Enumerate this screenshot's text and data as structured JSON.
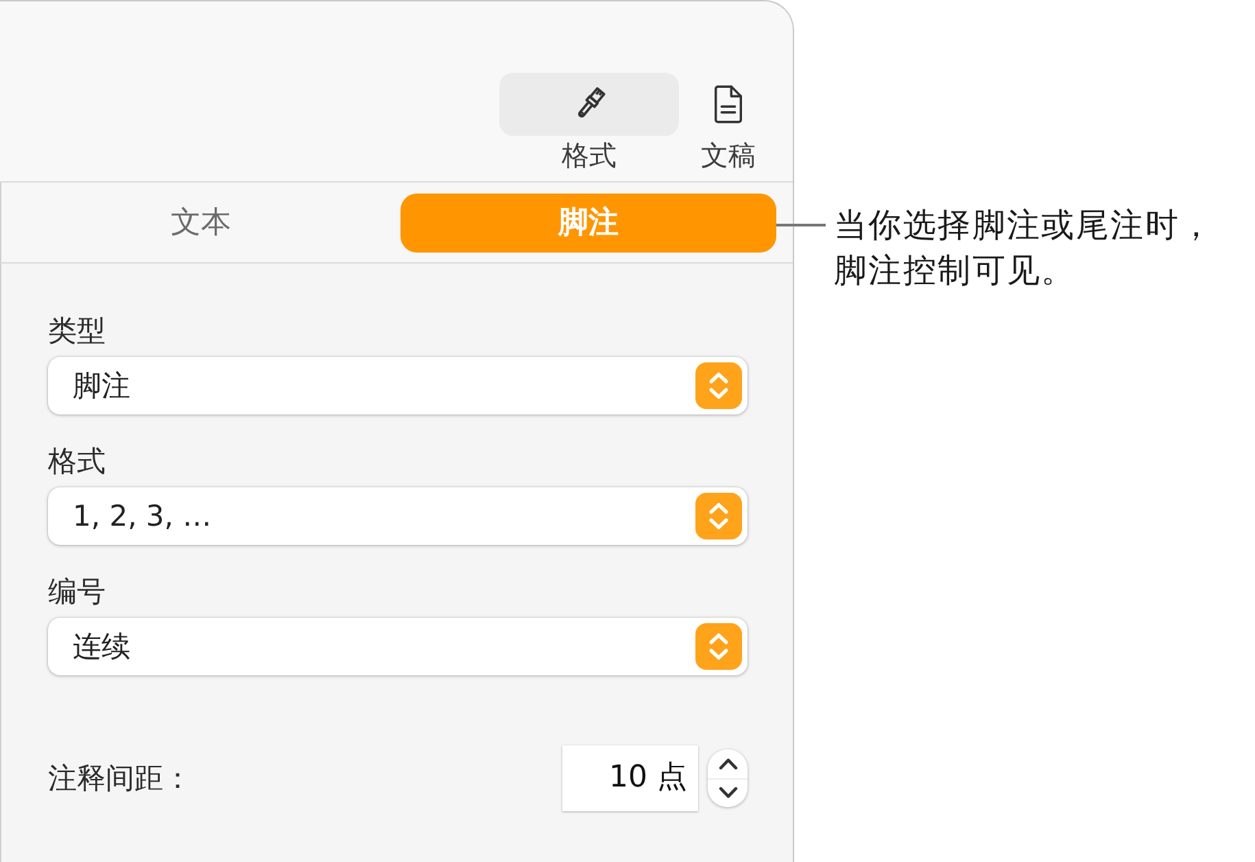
{
  "toolbar": {
    "buttons": [
      {
        "kind": "brush",
        "label": "格式",
        "selected": true
      },
      {
        "kind": "document",
        "label": "文稿",
        "selected": false
      }
    ]
  },
  "tabs": [
    {
      "label": "文本",
      "selected": false
    },
    {
      "label": "脚注",
      "selected": true
    }
  ],
  "fields": [
    {
      "label": "类型",
      "value": "脚注"
    },
    {
      "label": "格式",
      "value": "1, 2, 3, …"
    },
    {
      "label": "编号",
      "value": "连续"
    }
  ],
  "spacing": {
    "label": "注释间距：",
    "value": "10 点"
  },
  "callout": {
    "text": "当你选择脚注或尾注时，脚注控制可见。"
  }
}
